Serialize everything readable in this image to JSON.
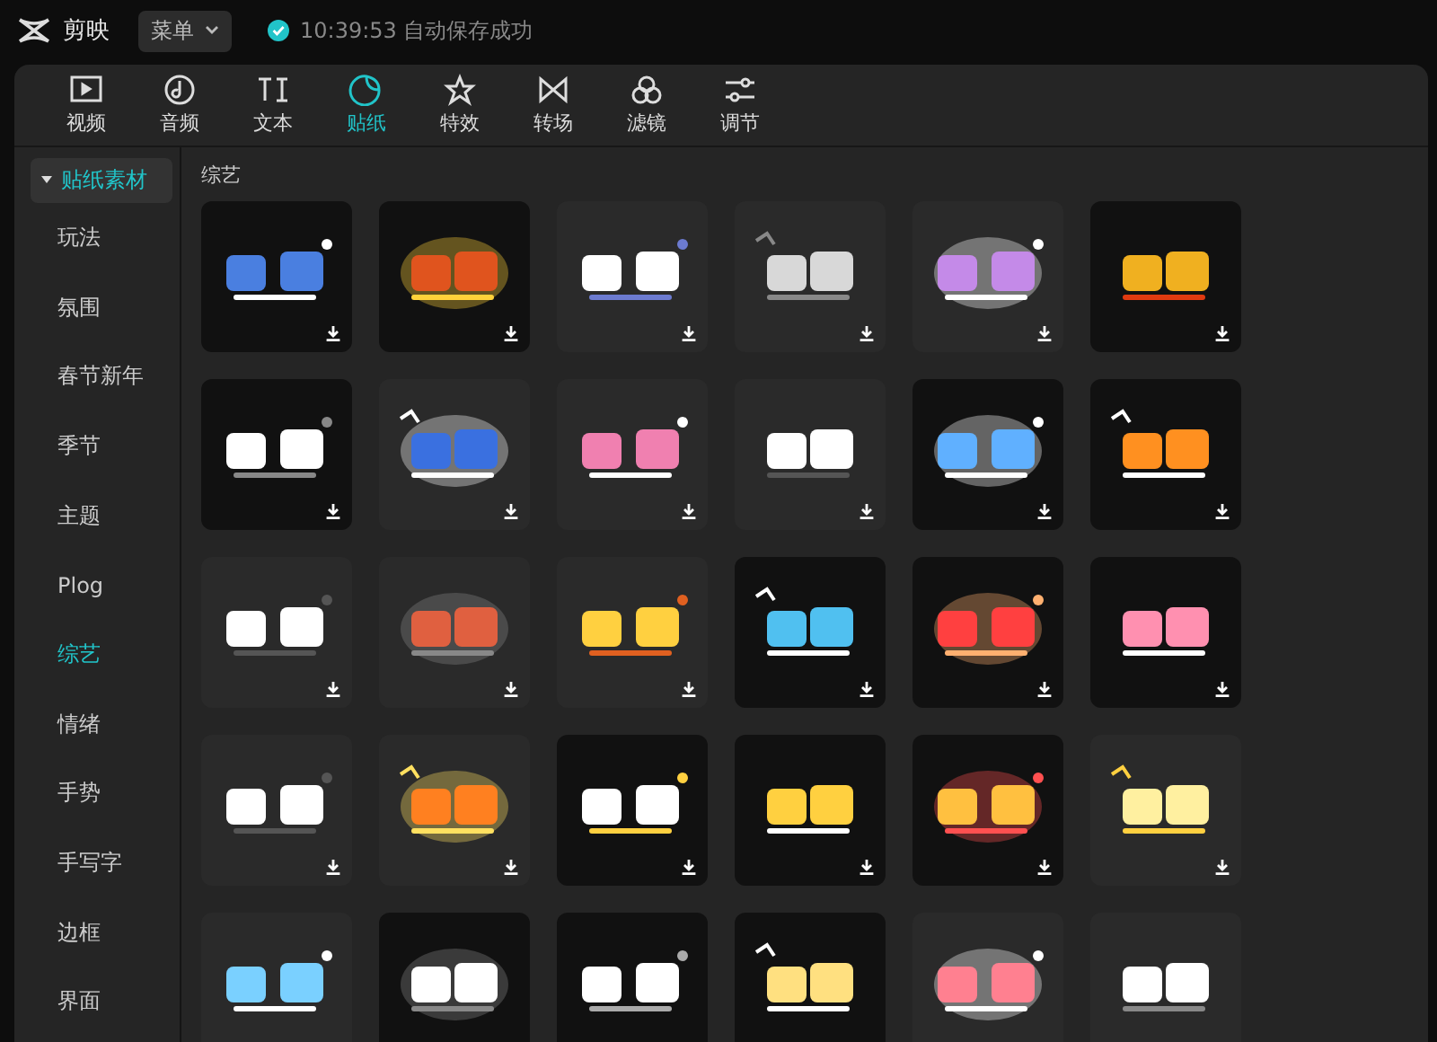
{
  "app": {
    "name": "剪映"
  },
  "menu_button": {
    "label": "菜单"
  },
  "save_status": {
    "time": "10:39:53",
    "message": "自动保存成功"
  },
  "tabs": [
    {
      "label": "视频",
      "kind": "video",
      "selected": false
    },
    {
      "label": "音频",
      "kind": "audio",
      "selected": false
    },
    {
      "label": "文本",
      "kind": "text",
      "selected": false
    },
    {
      "label": "贴纸",
      "kind": "sticker",
      "selected": true
    },
    {
      "label": "特效",
      "kind": "effect",
      "selected": false
    },
    {
      "label": "转场",
      "kind": "transition",
      "selected": false
    },
    {
      "label": "滤镜",
      "kind": "filter",
      "selected": false
    },
    {
      "label": "调节",
      "kind": "adjust",
      "selected": false
    }
  ],
  "sidebar": {
    "header": {
      "label": "贴纸素材",
      "expanded": true
    },
    "items": [
      {
        "label": "玩法",
        "selected": false
      },
      {
        "label": "氛围",
        "selected": false
      },
      {
        "label": "春节新年",
        "selected": false
      },
      {
        "label": "季节",
        "selected": false
      },
      {
        "label": "主题",
        "selected": false
      },
      {
        "label": "Plog",
        "selected": false
      },
      {
        "label": "综艺",
        "selected": true
      },
      {
        "label": "情绪",
        "selected": false
      },
      {
        "label": "手势",
        "selected": false
      },
      {
        "label": "手写字",
        "selected": false
      },
      {
        "label": "边框",
        "selected": false
      },
      {
        "label": "界面",
        "selected": false
      }
    ]
  },
  "section_title": "综艺",
  "stickers": [
    {
      "kind": "picture",
      "download": true
    },
    {
      "kind": "picture",
      "download": true
    },
    {
      "kind": "picture",
      "download": true
    },
    {
      "kind": "picture",
      "download": true
    },
    {
      "kind": "picture",
      "download": true
    },
    {
      "kind": "picture",
      "download": true
    },
    {
      "kind": "picture",
      "download": true
    },
    {
      "kind": "picture",
      "download": true
    },
    {
      "kind": "picture",
      "download": true
    },
    {
      "kind": "picture",
      "download": true
    },
    {
      "kind": "picture",
      "download": true
    },
    {
      "kind": "picture",
      "download": true
    },
    {
      "kind": "picture",
      "download": true
    },
    {
      "kind": "picture",
      "download": true
    },
    {
      "kind": "picture",
      "download": true
    },
    {
      "kind": "picture",
      "download": true
    },
    {
      "kind": "picture",
      "download": true
    },
    {
      "kind": "picture",
      "download": true
    },
    {
      "kind": "picture",
      "download": true
    },
    {
      "kind": "picture",
      "download": true
    },
    {
      "kind": "picture",
      "download": true
    },
    {
      "kind": "picture",
      "download": true
    },
    {
      "kind": "picture",
      "download": true
    },
    {
      "kind": "picture",
      "download": true
    },
    {
      "kind": "picture",
      "download": false
    },
    {
      "kind": "picture",
      "download": false
    },
    {
      "kind": "picture",
      "download": false
    },
    {
      "kind": "picture",
      "download": false
    },
    {
      "kind": "picture",
      "download": false
    },
    {
      "kind": "picture",
      "download": false
    }
  ]
}
